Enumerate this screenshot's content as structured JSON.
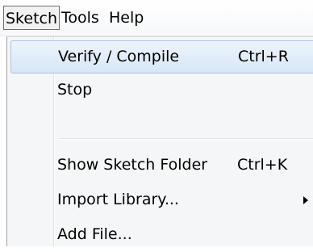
{
  "menubar": {
    "items": [
      {
        "label": "Sketch",
        "state": "open"
      },
      {
        "label": "Tools"
      },
      {
        "label": "Help"
      }
    ]
  },
  "menu": {
    "items": [
      {
        "label": "Verify / Compile",
        "shortcut": "Ctrl+R",
        "highlighted": true
      },
      {
        "label": "Stop",
        "shortcut": ""
      },
      {
        "label": "Show Sketch Folder",
        "shortcut": "Ctrl+K"
      },
      {
        "label": "Import Library...",
        "shortcut": "",
        "submenu": true
      },
      {
        "label": "Add File...",
        "shortcut": ""
      }
    ]
  },
  "icons": {
    "submenu_arrow": "chevron-right-icon"
  },
  "colors": {
    "highlight_border": "#a7c4e6",
    "highlight_fill": "#d7e6f7",
    "menu_background": "#f5f6f7"
  }
}
